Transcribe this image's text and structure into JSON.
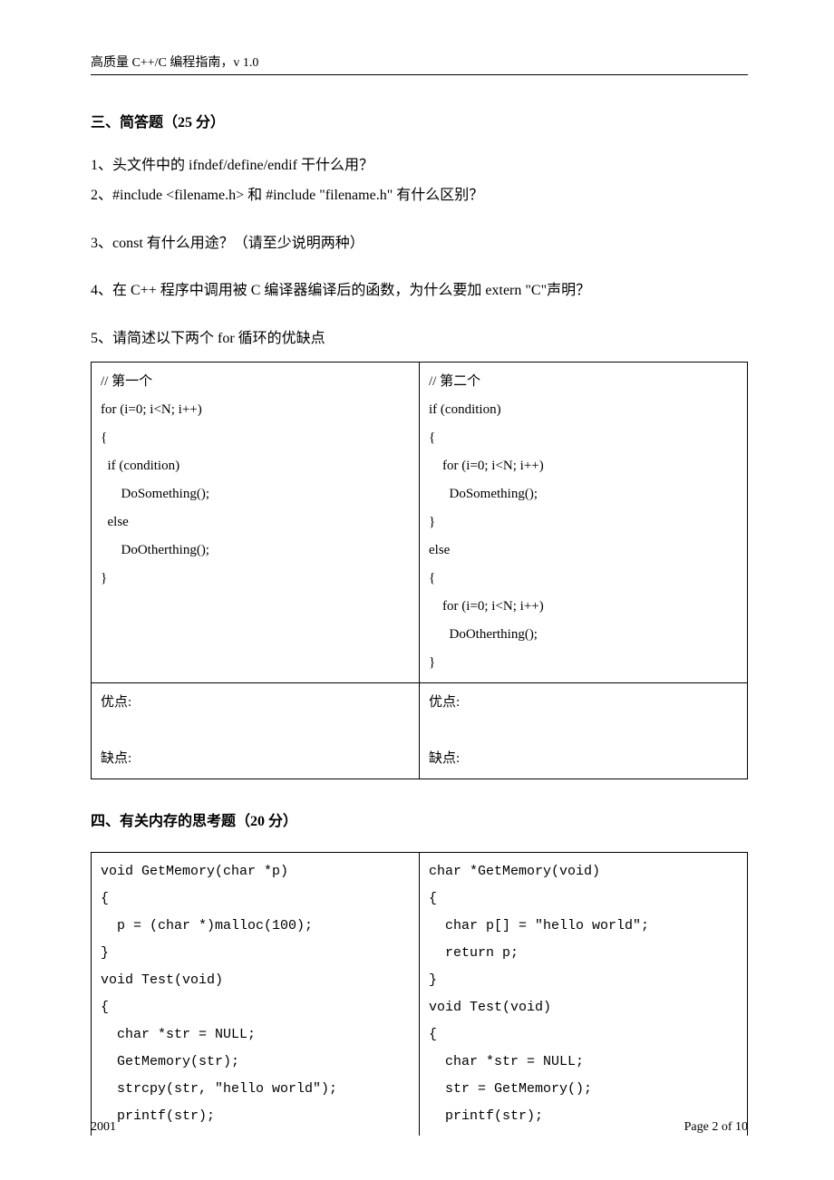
{
  "header": "高质量 C++/C 编程指南，v 1.0",
  "section3": {
    "title": "三、简答题（25 分）",
    "q1": "1、头文件中的 ifndef/define/endif 干什么用？",
    "q2": "2、#include   <filename.h>     和   #include   \"filename.h\" 有什么区别？",
    "q3": "3、const 有什么用途？（请至少说明两种）",
    "q4": "4、在 C++ 程序中调用被 C 编译器编译后的函数，为什么要加 extern \"C\"声明？",
    "q5": "5、请简述以下两个 for 循环的优缺点"
  },
  "codebox1": {
    "left": "// 第一个\nfor (i=0; i<N; i++)\n{\n  if (condition)\n      DoSomething();\n  else\n      DoOtherthing();\n}",
    "right": "// 第二个\nif (condition)\n{\n    for (i=0; i<N; i++)\n      DoSomething();\n}\nelse\n{\n    for (i=0; i<N; i++)\n      DoOtherthing();\n}",
    "left2": "优点:\n\n缺点:\n",
    "right2": "优点:\n\n缺点:\n"
  },
  "section4": {
    "title": "四、有关内存的思考题（20 分）"
  },
  "codebox2": {
    "left": "void GetMemory(char *p)\n{\n  p = (char *)malloc(100);\n}\nvoid Test(void)\n{\n  char *str = NULL;\n  GetMemory(str);\n  strcpy(str, \"hello world\");\n  printf(str);",
    "right": "char *GetMemory(void)\n{\n  char p[] = \"hello world\";\n  return p;\n}\nvoid Test(void)\n{\n  char *str = NULL;\n  str = GetMemory();\n  printf(str);"
  },
  "footer": {
    "left": "2001",
    "right": "Page 2 of 10"
  }
}
